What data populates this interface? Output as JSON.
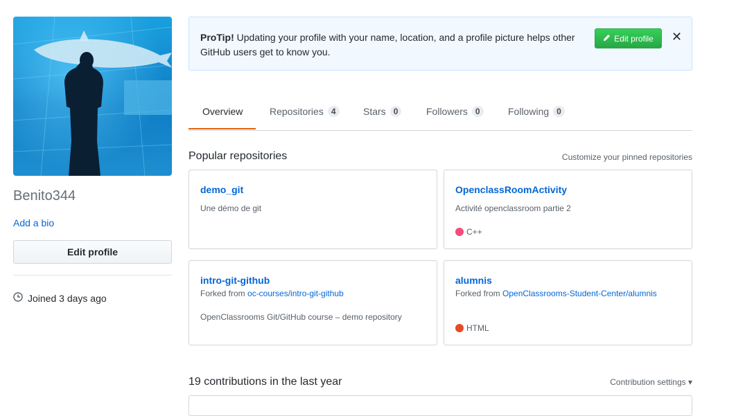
{
  "profile": {
    "username": "Benito344",
    "add_bio": "Add a bio",
    "edit_profile": "Edit profile",
    "joined": "Joined 3 days ago",
    "avatar_icon": "profile-photo"
  },
  "protip": {
    "label": "ProTip!",
    "text": " Updating your profile with your name, location, and a profile picture helps other GitHub users get to know you.",
    "button": "Edit profile",
    "close": "✕"
  },
  "tabs": [
    {
      "label": "Overview"
    },
    {
      "label": "Repositories",
      "count": "4"
    },
    {
      "label": "Stars",
      "count": "0"
    },
    {
      "label": "Followers",
      "count": "0"
    },
    {
      "label": "Following",
      "count": "0"
    }
  ],
  "popular": {
    "title": "Popular repositories",
    "customize": "Customize your pinned repositories",
    "repos": [
      {
        "name": "demo_git",
        "description": "Une démo de git"
      },
      {
        "name": "OpenclassRoomActivity",
        "description": "Activité openclassroom partie 2",
        "language": "C++",
        "language_color": "#f34b7d"
      },
      {
        "name": "intro-git-github",
        "forked_prefix": "Forked from ",
        "forked_from": "oc-courses/intro-git-github",
        "description": "OpenClassrooms Git/GitHub course – demo repository"
      },
      {
        "name": "alumnis",
        "forked_prefix": "Forked from ",
        "forked_from": "OpenClassrooms-Student-Center/alumnis",
        "language": "HTML",
        "language_color": "#e34c26"
      }
    ]
  },
  "contributions": {
    "title": "19 contributions in the last year",
    "settings": "Contribution settings ▾"
  }
}
